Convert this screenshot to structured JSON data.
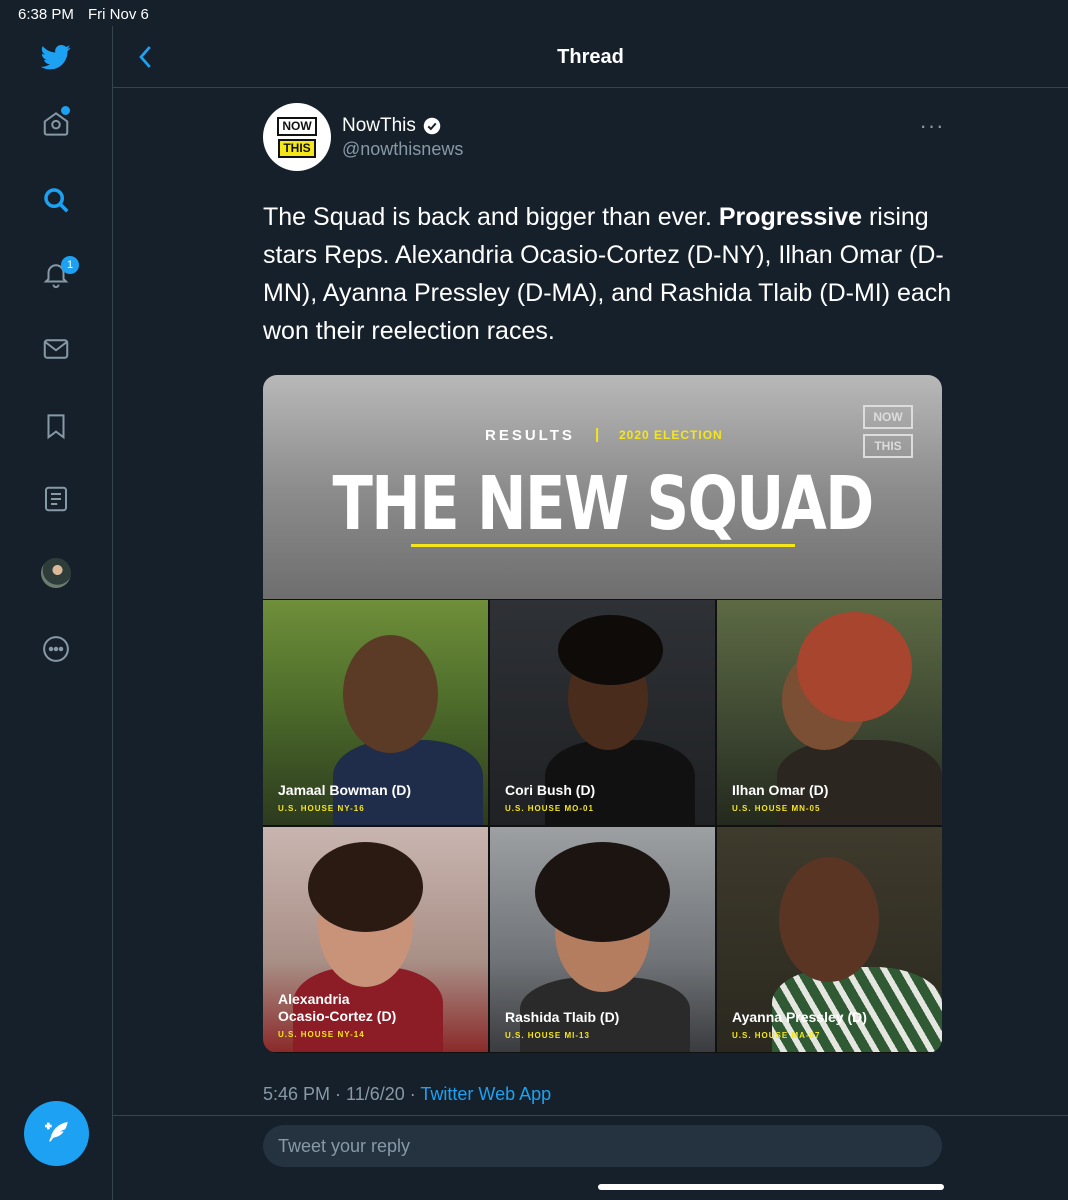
{
  "status_bar": {
    "time": "6:38 PM",
    "date": "Fri Nov 6"
  },
  "sidebar": {
    "items": [
      {
        "name": "twitter-logo-icon"
      },
      {
        "name": "home-icon"
      },
      {
        "name": "explore-icon"
      },
      {
        "name": "notifications-icon",
        "badge": "1"
      },
      {
        "name": "messages-icon"
      },
      {
        "name": "bookmarks-icon"
      },
      {
        "name": "lists-icon"
      },
      {
        "name": "profile-avatar"
      },
      {
        "name": "more-icon"
      }
    ],
    "compose_icon": "compose-tweet-icon"
  },
  "header": {
    "title": "Thread"
  },
  "tweet": {
    "author_name": "NowThis",
    "author_handle": "@nowthisnews",
    "avatar_top": "NOW",
    "avatar_bottom": "THIS",
    "text_part1": "The Squad is back and bigger than ever. ",
    "text_bold": "Progressive",
    "text_part2": " rising stars Reps. Alexandria Ocasio-Cortez (D-NY), Ilhan Omar (D-MN), Ayanna Pressley (D-MA), and Rashida Tlaib (D-MI) each won their reelection races.",
    "timestamp": "5:46 PM · 11/6/20 · ",
    "source": "Twitter Web App"
  },
  "media": {
    "results_label": "RESULTS",
    "separator": "|",
    "election_label": "2020 ELECTION",
    "headline": "THE NEW SQUAD",
    "logo_top": "NOW",
    "logo_bottom": "THIS",
    "people": [
      {
        "name": "Jamaal Bowman (D)",
        "seat": "U.S. HOUSE NY-16"
      },
      {
        "name": "Cori Bush (D)",
        "seat": "U.S. HOUSE MO-01"
      },
      {
        "name": "Ilhan Omar (D)",
        "seat": "U.S. HOUSE MN-05"
      },
      {
        "name": "Alexandria",
        "name2": "Ocasio-Cortez (D)",
        "seat": "U.S. HOUSE NY-14"
      },
      {
        "name": "Rashida Tlaib (D)",
        "seat": "U.S. HOUSE MI-13"
      },
      {
        "name": "Ayanna Pressley (D)",
        "seat": "U.S. HOUSE MA-07"
      }
    ]
  },
  "reply": {
    "placeholder": "Tweet your reply"
  },
  "colors": {
    "background": "#15202b",
    "accent": "#1da1f2",
    "muted": "#8899a6",
    "highlight": "#f5e61a"
  }
}
